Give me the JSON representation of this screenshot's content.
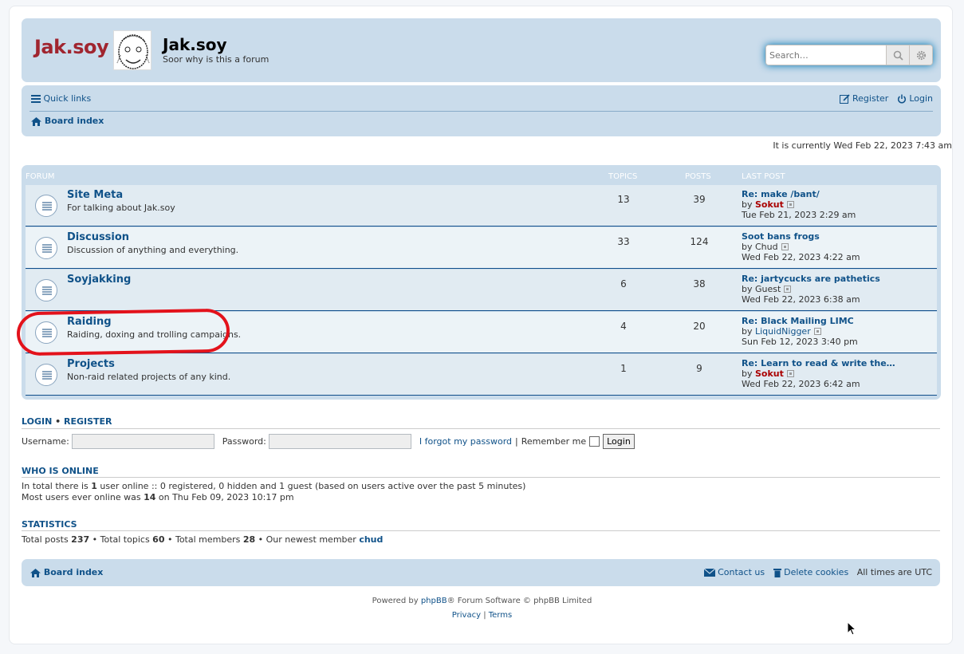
{
  "header": {
    "logo_text": "Jak.soy",
    "site_title": "Jak.soy",
    "site_description": "Soor why is this a forum",
    "search_placeholder": "Search…"
  },
  "navbar": {
    "quick_links": "Quick links",
    "register": "Register",
    "login": "Login",
    "board_index": "Board index"
  },
  "current_time": "It is currently Wed Feb 22, 2023 7:43 am",
  "forum_table": {
    "headers": {
      "forum": "FORUM",
      "topics": "TOPICS",
      "posts": "POSTS",
      "last_post": "LAST POST"
    },
    "rows": [
      {
        "name": "Site Meta",
        "desc": "For talking about Jak.soy",
        "topics": "13",
        "posts": "39",
        "lp_title": "Re: make /bant/",
        "lp_by": "by",
        "lp_user": "Sokut",
        "lp_date": "Tue Feb 21, 2023 2:29 am"
      },
      {
        "name": "Discussion",
        "desc": "Discussion of anything and everything.",
        "topics": "33",
        "posts": "124",
        "lp_title": "Soot bans frogs",
        "lp_by": "by",
        "lp_user": "Chud",
        "lp_date": "Wed Feb 22, 2023 4:22 am"
      },
      {
        "name": "Soyjakking",
        "desc": "",
        "topics": "6",
        "posts": "38",
        "lp_title": "Re: jartycucks are pathetics",
        "lp_by": "by",
        "lp_user": "Guest",
        "lp_date": "Wed Feb 22, 2023 6:38 am"
      },
      {
        "name": "Raiding",
        "desc": "Raiding, doxing and trolling campaigns.",
        "topics": "4",
        "posts": "20",
        "lp_title": "Re: Black Mailing LIMC",
        "lp_by": "by",
        "lp_user": "LiquidNigger",
        "lp_date": "Sun Feb 12, 2023 3:40 pm"
      },
      {
        "name": "Projects",
        "desc": "Non-raid related projects of any kind.",
        "topics": "1",
        "posts": "9",
        "lp_title": "Re: Learn to read & write the…",
        "lp_by": "by",
        "lp_user": "Sokut",
        "lp_date": "Wed Feb 22, 2023 6:42 am"
      }
    ]
  },
  "login_section": {
    "title_login": "LOGIN",
    "bullet": "•",
    "title_register": "REGISTER",
    "username_label": "Username:",
    "password_label": "Password:",
    "forgot": "I forgot my password",
    "pipe": "|",
    "remember": "Remember me",
    "button": "Login"
  },
  "who_is_online": {
    "title": "WHO IS ONLINE",
    "line1_a": "In total there is ",
    "line1_b": "1",
    "line1_c": " user online :: 0 registered, 0 hidden and 1 guest (based on users active over the past 5 minutes)",
    "line2_a": "Most users ever online was ",
    "line2_b": "14",
    "line2_c": " on Thu Feb 09, 2023 10:17 pm"
  },
  "statistics": {
    "title": "STATISTICS",
    "p1": "Total posts ",
    "v1": "237",
    "p2": " • Total topics ",
    "v2": "60",
    "p3": " • Total members ",
    "v3": "28",
    "p4": " • Our newest member ",
    "newest": "chud"
  },
  "footer": {
    "board_index": "Board index",
    "contact": "Contact us",
    "delete_cookies": "Delete cookies",
    "all_times": "All times are ",
    "tz": "UTC",
    "powered_a": "Powered by ",
    "powered_link": "phpBB",
    "powered_b": "® Forum Software © phpBB Limited",
    "privacy": "Privacy",
    "sep": "|",
    "terms": "Terms"
  },
  "colors": {
    "accent": "#105289",
    "panel": "#cadceb",
    "highlight": "#e3121b",
    "admin": "#aa0000"
  }
}
